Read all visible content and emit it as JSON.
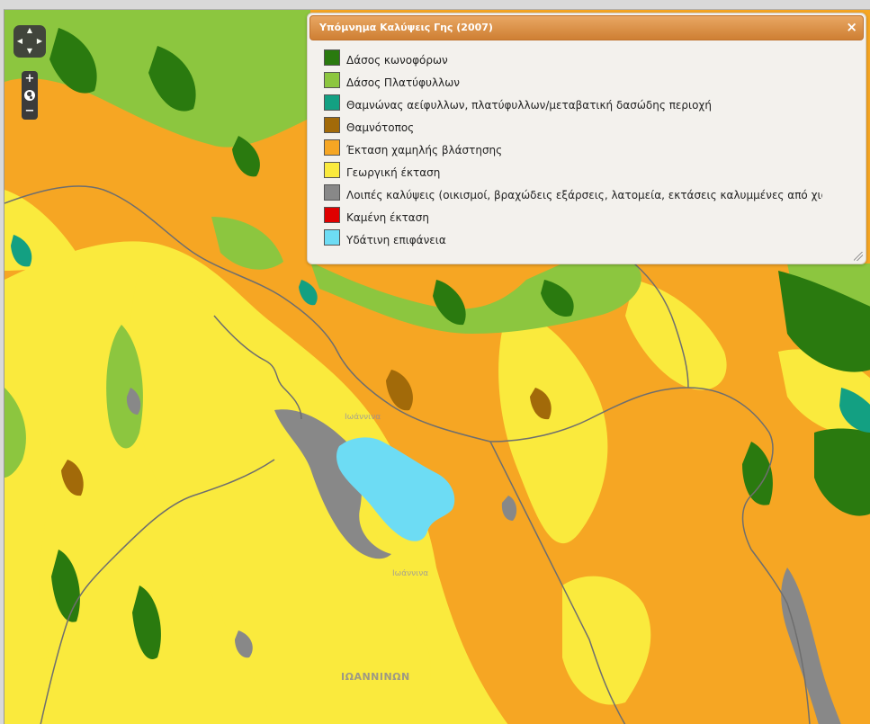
{
  "map": {
    "labels": {
      "town1": "Ιωάννινα",
      "town2": "Ιωάννινα",
      "region": "ΙΩΑΝΝΙΝΩΝ"
    },
    "land_colors": {
      "coniferous": "#2a7a0f",
      "broadleaf": "#8cc63f",
      "shrub": "#13a082",
      "scrubland": "#a26a09",
      "low_vegetation": "#f6a623",
      "agricultural": "#faea3d",
      "other": "#888888",
      "burned": "#e00000",
      "water": "#6ddcf4",
      "boundary": "#6e6e6e"
    }
  },
  "controls": {
    "pan": {
      "up": "▲",
      "down": "▼",
      "left": "◀",
      "right": "▶"
    },
    "zoom_in": "+",
    "zoom_out": "−"
  },
  "legend": {
    "title": "Υπόμνημα Καλύψεις Γης (2007)",
    "close": "×",
    "items": [
      {
        "label": "Δάσος κωνοφόρων",
        "color": "#2a7a0f"
      },
      {
        "label": "Δάσος Πλατύφυλλων",
        "color": "#8cc63f"
      },
      {
        "label": "Θαμνώνας αείφυλλων, πλατύφυλλων/μεταβατική δασώδης περιοχή",
        "color": "#13a082"
      },
      {
        "label": "Θαμνότοπος",
        "color": "#a26a09"
      },
      {
        "label": "Έκταση χαμηλής βλάστησης",
        "color": "#f6a623"
      },
      {
        "label": "Γεωργική έκταση",
        "color": "#faea3d"
      },
      {
        "label": "Λοιπές καλύψεις (οικισμοί, βραχώδεις εξάρσεις, λατομεία, εκτάσεις καλυμμένες από χιόνι)",
        "color": "#888888"
      },
      {
        "label": "Καμένη έκταση",
        "color": "#e00000"
      },
      {
        "label": "Υδάτινη επιφάνεια",
        "color": "#6ddcf4"
      }
    ]
  }
}
